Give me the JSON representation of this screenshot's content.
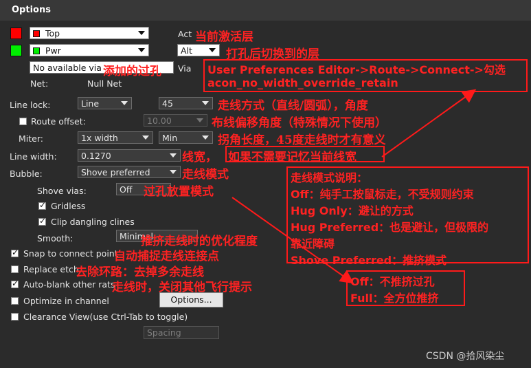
{
  "window": {
    "title": "Options"
  },
  "layers": {
    "active": {
      "value": "Top",
      "color": "#ff0000",
      "label": "Act"
    },
    "alternate": {
      "value": "Pwr",
      "color": "#00ee00",
      "combo": "Alt"
    },
    "via": {
      "value": "No available via",
      "label": "Via"
    },
    "net_label": "Net:",
    "net_value": "Null Net"
  },
  "line_lock": {
    "label": "Line lock:",
    "mode": "Line",
    "angle": "45"
  },
  "route_offset": {
    "label": "Route offset:",
    "value": "10.00"
  },
  "miter": {
    "label": "Miter:",
    "size": "1x width",
    "mode": "Min"
  },
  "line_width": {
    "label": "Line width:",
    "value": "0.1270"
  },
  "bubble": {
    "label": "Bubble:",
    "value": "Shove preferred"
  },
  "shove_vias": {
    "label": "Shove vias:",
    "value": "Off"
  },
  "gridless": {
    "label": "Gridless"
  },
  "clip_dangling": {
    "label": "Clip dangling clines"
  },
  "smooth": {
    "label": "Smooth:",
    "value": "Minimal"
  },
  "options": {
    "snap": "Snap to connect point",
    "replace_etch": "Replace etch",
    "auto_blank": "Auto-blank other rats",
    "optimize": "Optimize in channel",
    "options_button": "Options...",
    "clearance_view": "Clearance View(use Ctrl-Tab to toggle)",
    "spacing": "Spacing"
  },
  "annotations": {
    "act": "当前激活层",
    "alt": "打孔后切换到的层",
    "via": "添加的过孔",
    "pref_line1": "User Preferences Editor->Route->Connect->勾选",
    "pref_line2": "acon_no_width_override_retain",
    "line_lock": "走线方式（直线/圆弧），角度",
    "route_offset": "布线偏移角度（特殊情况下使用）",
    "miter": "拐角长度，45度走线时才有意义",
    "line_width_a": "线宽，",
    "line_width_b": "如果不需要记忆当前线宽",
    "bubble": "走线模式",
    "shove_vias": "过孔放置模式",
    "smooth": "推挤走线时的优化程度",
    "snap": "自动捕捉走线连接点",
    "replace_etch": "去除环路：去掉多余走线",
    "auto_blank": "走线时，关闭其他飞行提示",
    "modes_title": "走线模式说明：",
    "mode_off": "Off：纯手工按鼠标走，不受规则约束",
    "mode_hug_only": "Hug Only：避让的方式",
    "mode_hug_pref1": "Hug Preferred：也是避让，但极限的",
    "mode_hug_pref2": "靠近障碍",
    "mode_shove": "Shove Preferred：推挤模式",
    "via_off": "Off：不推挤过孔",
    "via_full": "Full：全方位推挤"
  },
  "watermark": "CSDN @拾风染尘"
}
